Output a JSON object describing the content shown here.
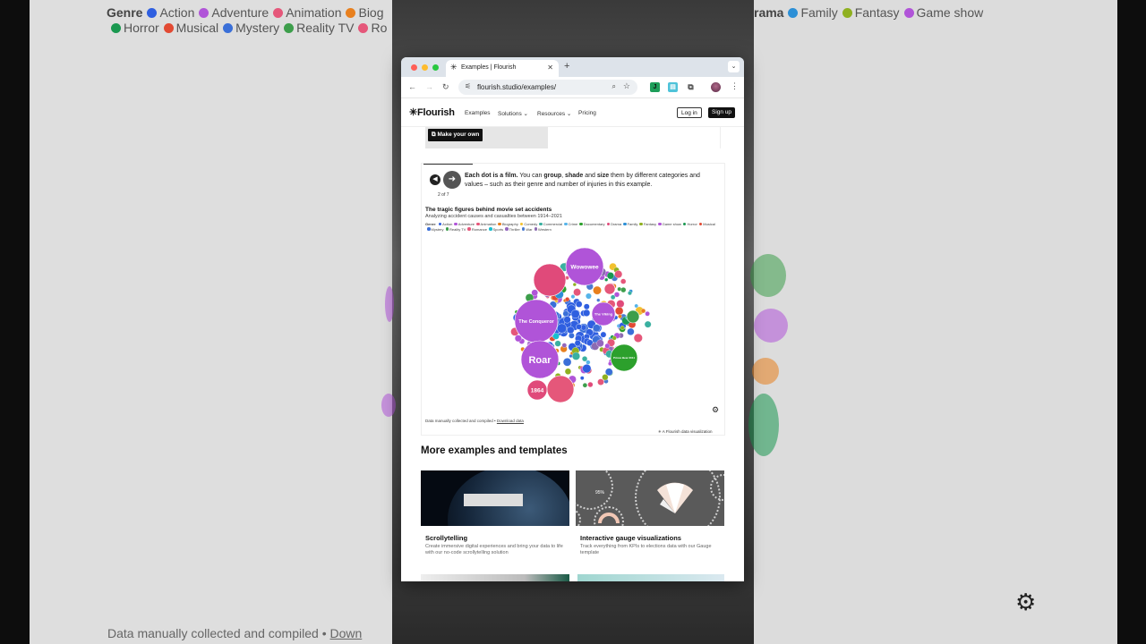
{
  "background": {
    "legend_row1": [
      {
        "label": "Genre",
        "color": ""
      },
      {
        "label": "Action",
        "color": "#2f5fe0"
      },
      {
        "label": "Adventure",
        "color": "#b054d8"
      },
      {
        "label": "Animation",
        "color": "#e5577a"
      },
      {
        "label": "Biog",
        "color": "#e8801e"
      }
    ],
    "legend_row2": [
      {
        "label": "Horror",
        "color": "#1a9850"
      },
      {
        "label": "Musical",
        "color": "#e24a33"
      },
      {
        "label": "Mystery",
        "color": "#3a6fd8"
      },
      {
        "label": "Reality TV",
        "color": "#3d9e4b"
      },
      {
        "label": "Ro",
        "color": "#e5577a"
      }
    ],
    "legend_right": [
      {
        "label": "rama",
        "color": ""
      },
      {
        "label": "Family",
        "color": "#2c8fd6"
      },
      {
        "label": "Fantasy",
        "color": "#8fb020"
      },
      {
        "label": "Game show",
        "color": "#b054d8"
      }
    ],
    "footer_text": "Data manually collected and compiled • ",
    "footer_link": "Down"
  },
  "browser": {
    "tab_title": "Examples | Flourish",
    "tab_favicon": "flourish-asterisk-icon",
    "url": "flourish.studio/examples/"
  },
  "site": {
    "logo": "✳Flourish",
    "nav": [
      "Examples",
      "Solutions ⌄",
      "Resources ⌄",
      "Pricing"
    ],
    "login": "Log in",
    "signup": "Sign up",
    "make_your_own": "Make your own"
  },
  "story": {
    "counter": "2 of 7",
    "step_bold": "Each dot is a film.",
    "step_pre": " You can ",
    "kw1": "group",
    "sep1": ", ",
    "kw2": "shade",
    "sep2": " and ",
    "kw3": "size",
    "step_rest": " them by different categories and values – such as their genre and number of injuries in this example."
  },
  "chart_data": {
    "type": "bubble",
    "title": "The tragic figures behind movie set accidents",
    "subtitle": "Analyzing accident causes and casualties between 1914–2021",
    "legend_title": "Genre",
    "legend": [
      {
        "name": "Action",
        "color": "#2f5fe0"
      },
      {
        "name": "Adventure",
        "color": "#b054d8"
      },
      {
        "name": "Animation",
        "color": "#e5577a"
      },
      {
        "name": "Biography",
        "color": "#e8801e"
      },
      {
        "name": "Comedy",
        "color": "#f2c12e"
      },
      {
        "name": "Commercial",
        "color": "#3ab0a0"
      },
      {
        "name": "Crime",
        "color": "#56b4e9"
      },
      {
        "name": "Documentary",
        "color": "#2ca02c"
      },
      {
        "name": "Drama",
        "color": "#e04a7a"
      },
      {
        "name": "Family",
        "color": "#2c8fd6"
      },
      {
        "name": "Fantasy",
        "color": "#8fb020"
      },
      {
        "name": "Game show",
        "color": "#b054d8"
      },
      {
        "name": "Horror",
        "color": "#1a9850"
      },
      {
        "name": "Musical",
        "color": "#e24a33"
      },
      {
        "name": "Mystery",
        "color": "#3a6fd8"
      },
      {
        "name": "Reality TV",
        "color": "#3d9e4b"
      },
      {
        "name": "Romance",
        "color": "#e5577a"
      },
      {
        "name": "Sports",
        "color": "#17becf"
      },
      {
        "name": "Thriller",
        "color": "#9467bd"
      },
      {
        "name": "War",
        "color": "#4a7bd0"
      },
      {
        "name": "Western",
        "color": "#8c6bb1"
      }
    ],
    "labeled_films": [
      {
        "name": "Wowowee",
        "genre": "Game show"
      },
      {
        "name": "The Conqueror",
        "genre": "Adventure"
      },
      {
        "name": "Roar",
        "genre": "Adventure"
      },
      {
        "name": "1864",
        "genre": "Drama"
      },
      {
        "name": "The Viking",
        "genre": "Adventure"
      },
      {
        "name": "Prince Bear 2011",
        "genre": "Documentary"
      }
    ],
    "source_text": "Data manually collected and compiled • ",
    "source_link": "Download data",
    "credit": "A Flourish data visualization"
  },
  "more": {
    "title": "More examples and templates",
    "templates": [
      {
        "name": "Scrollytelling",
        "desc": "Create immersive digital experiences and bring your data to life with our no-code scrollytelling solution"
      },
      {
        "name": "Interactive gauge visualizations",
        "desc": "Track everything from KPIs to elections data with our Gauge template"
      }
    ],
    "gauge_value": "95%"
  },
  "colors": {
    "accent": "#111111",
    "tab_bar": "#dde3ea"
  }
}
